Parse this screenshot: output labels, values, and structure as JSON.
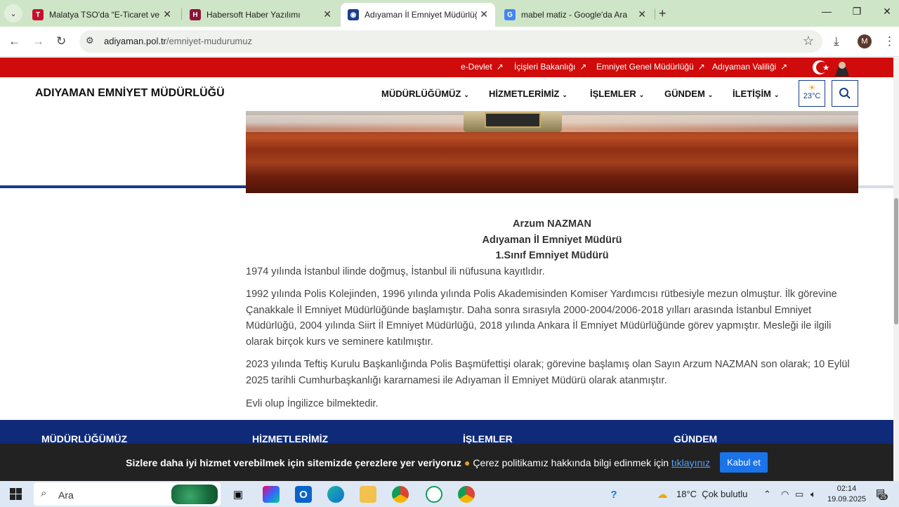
{
  "browser": {
    "tabs": [
      {
        "title": "Malatya TSO'da “E-Ticaret ve Ya",
        "favicon_color": "#c8102e",
        "favicon_char": "T"
      },
      {
        "title": "Habersoft Haber Yazılımı",
        "favicon_color": "#8a1538",
        "favicon_char": "H"
      },
      {
        "title": "Adıyaman İl Emniyet Müdürlüğ",
        "favicon_color": "#1a3d8c",
        "favicon_char": "◉"
      },
      {
        "title": "mabel matiz - Google'da Ara",
        "favicon_color": "#4285f4",
        "favicon_char": "G"
      }
    ],
    "url_domain": "adiyaman.pol.tr",
    "url_path": "/emniyet-mudurumuz",
    "profile_initial": "M"
  },
  "topbar": {
    "links": [
      "e-Devlet",
      "İçişleri Bakanlığı",
      "Emniyet Genel Müdürlüğü",
      "Adıyaman Valiliği"
    ]
  },
  "header": {
    "site_title": "ADIYAMAN EMNİYET MÜDÜRLÜĞÜ",
    "menu": [
      "MÜDÜRLÜĞÜMÜZ",
      "HİZMETLERİMİZ",
      "İŞLEMLER",
      "GÜNDEM",
      "İLETİŞİM"
    ],
    "temperature": "23°C"
  },
  "article": {
    "name": "Arzum NAZMAN",
    "position": "Adıyaman İl Emniyet Müdürü",
    "rank": "1.Sınıf Emniyet Müdürü",
    "paragraphs": [
      "1974 yılında İstanbul ilinde doğmuş, İstanbul ili nüfusuna kayıtlıdır.",
      "1992 yılında Polis Kolejinden, 1996 yılında yılında Polis Akademisinden Komiser Yardımcısı rütbesiyle mezun olmuştur. İlk görevine Çanakkale İl Emniyet Müdürlüğünde başlamıştır. Daha sonra sırasıyla 2000-2004/2006-2018 yılları arasında İstanbul Emniyet Müdürlüğü,  2004 yılında Siirt İl Emniyet Müdürlüğü, 2018 yılında Ankara İl Emniyet Müdürlüğünde görev yapmıştır. Mesleği ile ilgili olarak birçok kurs ve seminere katılmıştır.",
      "2023 yılında Teftiş Kurulu Başkanlığında Polis Başmüfettişi olarak; görevine başlamış olan Sayın Arzum NAZMAN son olarak; 10 Eylül 2025 tarihli Cumhurbaşkanlığı kararnamesi ile Adıyaman İl Emniyet Müdürü olarak atanmıştır.",
      "Evli olup İngilizce bilmektedir."
    ]
  },
  "footer": {
    "headings": [
      "MÜDÜRLÜĞÜMÜZ",
      "HİZMETLERİMİZ",
      "İŞLEMLER",
      "GÜNDEM"
    ]
  },
  "cookie": {
    "bold_text": "Sizlere daha iyi hizmet verebilmek için sitemizde çerezlere yer veriyoruz",
    "text": "Çerez politikamız hakkında bilgi edinmek için",
    "link": "tıklayınız",
    "button": "Kabul et"
  },
  "taskbar": {
    "search_placeholder": "Ara",
    "weather_temp": "18°C",
    "weather_desc": "Çok bulutlu",
    "time": "02:14",
    "date": "19.09.2025",
    "notification_count": "25"
  },
  "colors": {
    "red_bar": "#d00b0b",
    "navy": "#163d8c",
    "footer": "#0f2a78",
    "cookie_button": "#1a73e8"
  }
}
